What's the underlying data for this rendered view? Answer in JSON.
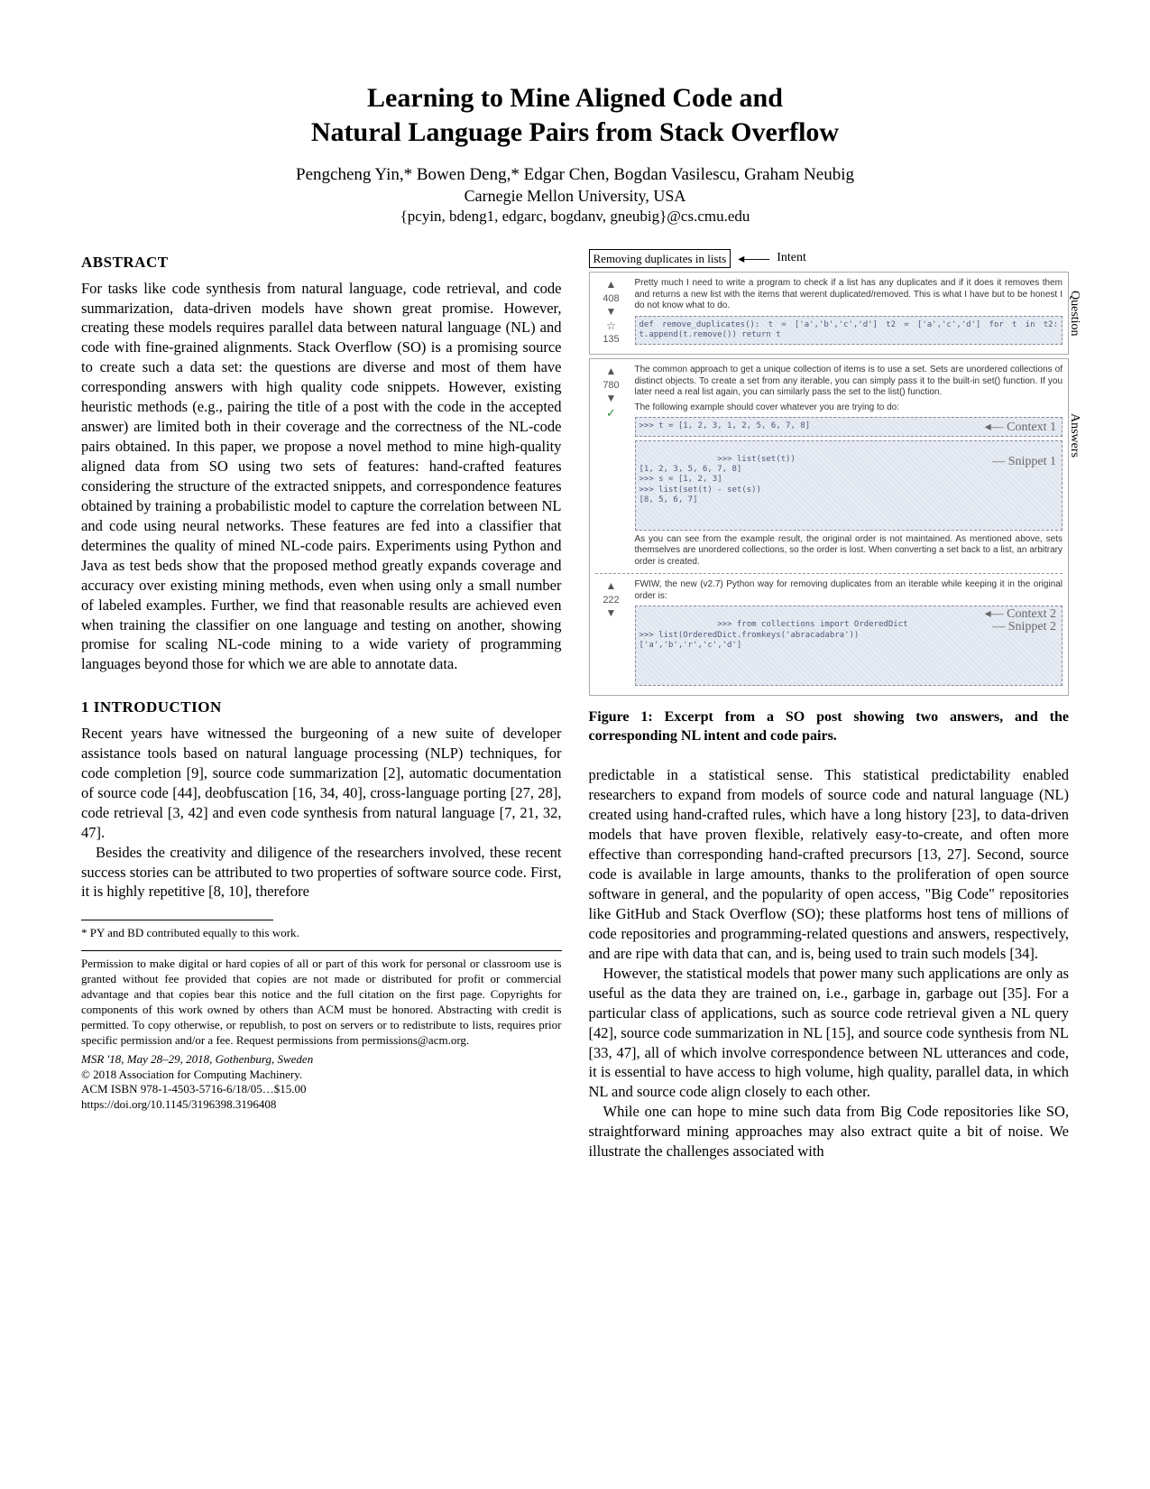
{
  "title_l1": "Learning to Mine Aligned Code and",
  "title_l2": "Natural Language Pairs from Stack Overflow",
  "authors": "Pengcheng Yin,* Bowen Deng,* Edgar Chen, Bogdan Vasilescu, Graham Neubig",
  "affiliation": "Carnegie Mellon University, USA",
  "emails": "{pcyin, bdeng1, edgarc, bogdanv, gneubig}@cs.cmu.edu",
  "headings": {
    "abstract": "ABSTRACT",
    "intro": "1   INTRODUCTION"
  },
  "abstract": "For tasks like code synthesis from natural language, code retrieval, and code summarization, data-driven models have shown great promise. However, creating these models requires parallel data between natural language (NL) and code with fine-grained alignments. Stack Overflow (SO) is a promising source to create such a data set: the questions are diverse and most of them have corresponding answers with high quality code snippets. However, existing heuristic methods (e.g., pairing the title of a post with the code in the accepted answer) are limited both in their coverage and the correctness of the NL-code pairs obtained. In this paper, we propose a novel method to mine high-quality aligned data from SO using two sets of features: hand-crafted features considering the structure of the extracted snippets, and correspondence features obtained by training a probabilistic model to capture the correlation between NL and code using neural networks. These features are fed into a classifier that determines the quality of mined NL-code pairs. Experiments using Python and Java as test beds show that the proposed method greatly expands coverage and accuracy over existing mining methods, even when using only a small number of labeled examples. Further, we find that reasonable results are achieved even when training the classifier on one language and testing on another, showing promise for scaling NL-code mining to a wide variety of programming languages beyond those for which we are able to annotate data.",
  "intro_p1": "Recent years  have witnessed the burgeoning of a new suite of developer assistance tools based on natural language processing (NLP) techniques, for code completion [9], source code summarization [2], automatic documentation of source code [44], deobfuscation [16, 34, 40], cross-language porting [27, 28], code retrieval [3, 42] and even code synthesis from natural language [7, 21, 32, 47].",
  "intro_p2": "Besides the creativity and diligence of the researchers involved, these recent success stories can be attributed to two properties of software source code. First, it is highly repetitive [8, 10], therefore",
  "footnote_star": "* PY and BD contributed equally to this work.",
  "permission": "Permission to make digital or hard copies of all or part of this work for personal or classroom use is granted without fee provided that copies are not made or distributed for profit or commercial advantage and that copies bear this notice and the full citation on the first page. Copyrights for components of this work owned by others than ACM must be honored. Abstracting with credit is permitted. To copy otherwise, or republish, to post on servers or to redistribute to lists, requires prior specific permission and/or a fee. Request permissions from permissions@acm.org.",
  "venue": "MSR '18, May 28–29, 2018, Gothenburg, Sweden",
  "copyright": "© 2018 Association for Computing Machinery.",
  "isbn": "ACM ISBN 978-1-4503-5716-6/18/05…$15.00",
  "doi": "https://doi.org/10.1145/3196398.3196408",
  "fig": {
    "qtitle": "Removing duplicates in lists",
    "intent_label": "Intent",
    "question_label": "Question",
    "answers_label": "Answers",
    "q_votes": "408",
    "q_fav": "135",
    "q_text": "Pretty much I need to write a program to check if a list has any duplicates and if it does it removes them and returns a new list with the items that werent duplicated/removed. This is what I have but to be honest I do not know what to do.",
    "q_code": "def remove_duplicates():\n    t = ['a','b','c','d']\n    t2 = ['a','c','d']\n    for t in t2:\n        t.append(t.remove())\n    return t",
    "a1_votes": "780",
    "a1_text1": "The common approach to get a unique collection of items is to use a set. Sets are unordered collections of distinct objects. To create a set from any iterable, you can simply pass it to the built-in set() function. If you later need a real list again, you can similarly pass the set to the list() function.",
    "a1_text2": "The following example should cover whatever you are trying to do:",
    "a1_code1": ">>> t = [1, 2, 3, 1, 2, 5, 6, 7, 8]",
    "context1_label": "Context 1",
    "a1_code2": ">>> list(set(t))\n[1, 2, 3, 5, 6, 7, 8]\n>>> s = [1, 2, 3]\n>>> list(set(t) - set(s))\n[8, 5, 6, 7]",
    "snippet1_label": "Snippet 1",
    "a1_text3": "As you can see from the example result, the original order is not maintained. As mentioned above, sets themselves are unordered collections, so the order is lost. When converting a set back to a list, an arbitrary order is created.",
    "a2_votes": "222",
    "a2_text": "FWIW, the new (v2.7) Python way for removing duplicates from an iterable while keeping it in the original order is:",
    "a2_code": ">>> from collections import OrderedDict\n>>> list(OrderedDict.fromkeys('abracadabra'))\n['a','b','r','c','d']",
    "context2_label": "Context 2",
    "snippet2_label": "Snippet 2",
    "caption": "Figure 1: Excerpt from a SO post showing two answers, and the corresponding NL intent and code pairs."
  },
  "col2_p1": "predictable in a statistical sense. This statistical predictability enabled researchers to expand from models of source code and natural language (NL) created using hand-crafted rules, which have a long history [23], to data-driven models that have proven flexible, relatively easy-to-create, and often more effective than corresponding hand-crafted precursors [13, 27]. Second, source code is available in large amounts, thanks to the proliferation of open source software in general, and the popularity of open access, \"Big Code\" repositories like GitHub and Stack Overflow (SO); these platforms host tens of millions of code repositories and programming-related questions and answers, respectively, and are ripe with data that can, and is, being used to train such models [34].",
  "col2_p2": "However, the statistical models that power many such applications are only as useful as the data they are trained on, i.e., garbage in, garbage out [35]. For a particular class of applications, such as source code retrieval given a NL query [42], source code summarization in NL [15], and source code synthesis from NL [33, 47], all of which involve correspondence between NL utterances and code, it is essential to have access to high volume, high quality, parallel data, in which NL and source code align closely to each other.",
  "col2_p3": "While one can hope to mine such data from Big Code repositories like SO, straightforward mining approaches may also extract quite a bit of noise. We illustrate the challenges associated with"
}
